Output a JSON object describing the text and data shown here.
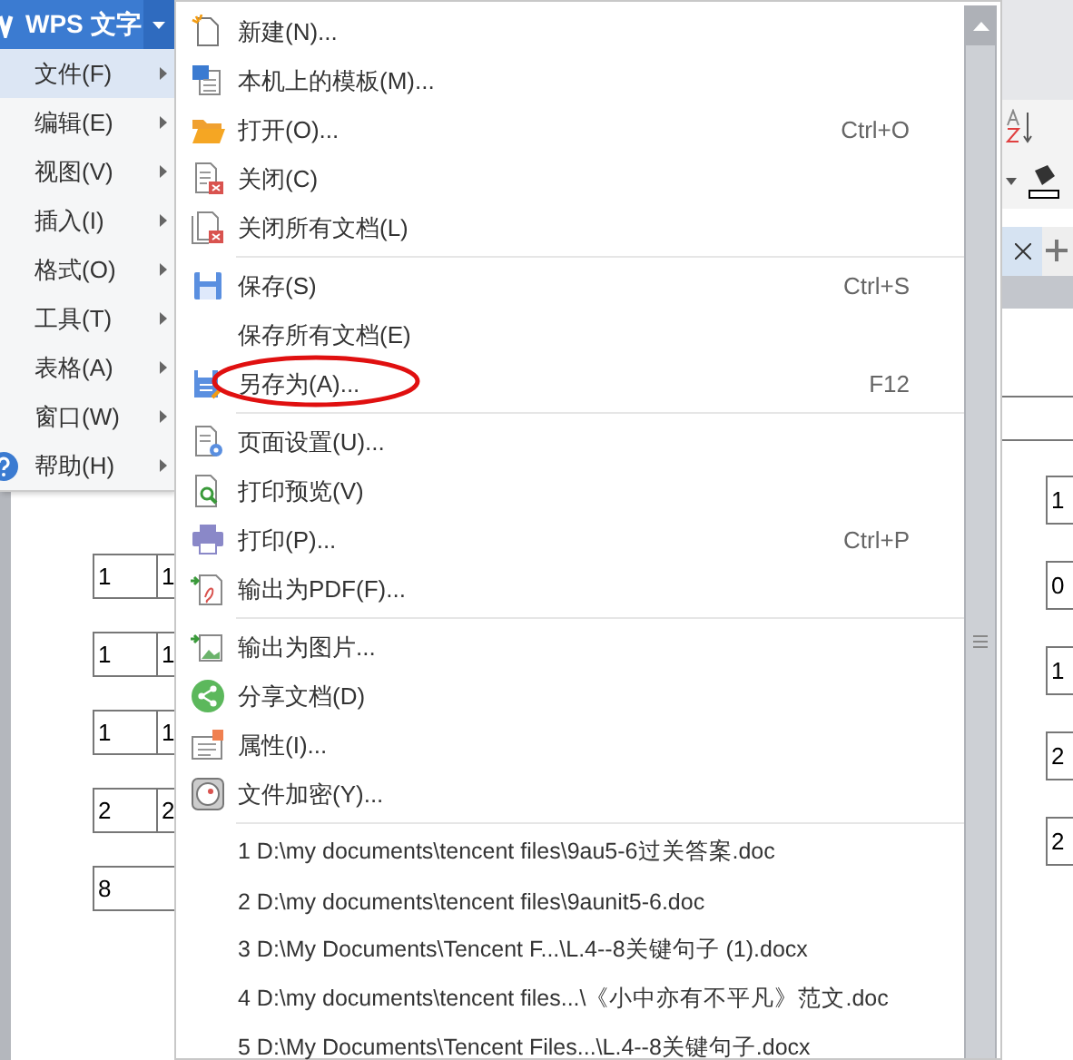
{
  "app": {
    "title": "WPS 文字"
  },
  "main_menu": {
    "items": [
      {
        "label": "文件(F)",
        "selected": true,
        "kind": "plain"
      },
      {
        "label": "编辑(E)",
        "selected": false,
        "kind": "plain"
      },
      {
        "label": "视图(V)",
        "selected": false,
        "kind": "plain"
      },
      {
        "label": "插入(I)",
        "selected": false,
        "kind": "plain"
      },
      {
        "label": "格式(O)",
        "selected": false,
        "kind": "plain"
      },
      {
        "label": "工具(T)",
        "selected": false,
        "kind": "plain"
      },
      {
        "label": "表格(A)",
        "selected": false,
        "kind": "plain"
      },
      {
        "label": "窗口(W)",
        "selected": false,
        "kind": "plain"
      },
      {
        "label": "帮助(H)",
        "selected": false,
        "kind": "help"
      }
    ]
  },
  "file_menu": {
    "sections": [
      [
        {
          "label": "新建(N)..."
        },
        {
          "label": "本机上的模板(M)..."
        },
        {
          "label": "打开(O)...",
          "shortcut": "Ctrl+O"
        },
        {
          "label": "关闭(C)"
        },
        {
          "label": "关闭所有文档(L)"
        }
      ],
      [
        {
          "label": "保存(S)",
          "shortcut": "Ctrl+S"
        },
        {
          "label": "保存所有文档(E)"
        },
        {
          "label": "另存为(A)...",
          "shortcut": "F12",
          "circled": true
        }
      ],
      [
        {
          "label": "页面设置(U)..."
        },
        {
          "label": "打印预览(V)"
        },
        {
          "label": "打印(P)...",
          "shortcut": "Ctrl+P"
        },
        {
          "label": "输出为PDF(F)..."
        }
      ],
      [
        {
          "label": "输出为图片..."
        },
        {
          "label": "分享文档(D)"
        },
        {
          "label": "属性(I)..."
        },
        {
          "label": "文件加密(Y)..."
        }
      ]
    ],
    "recent_files": [
      "1 D:\\my documents\\tencent files\\9au5-6过关答案.doc",
      "2 D:\\my documents\\tencent files\\9aunit5-6.doc",
      "3 D:\\My Documents\\Tencent F...\\L.4--8关键句子 (1).docx",
      "4 D:\\my documents\\tencent files...\\《小中亦有不平凡》范文.doc",
      "5 D:\\My Documents\\Tencent Files...\\L.4--8关键句子.docx"
    ]
  },
  "document": {
    "left_rows": [
      [
        "1",
        "1"
      ],
      [
        "1",
        "1"
      ],
      [
        "1",
        "1"
      ],
      [
        "2",
        "2"
      ],
      [
        "8"
      ]
    ],
    "right_cells": [
      "1",
      "0",
      "1",
      "2",
      "2"
    ]
  }
}
